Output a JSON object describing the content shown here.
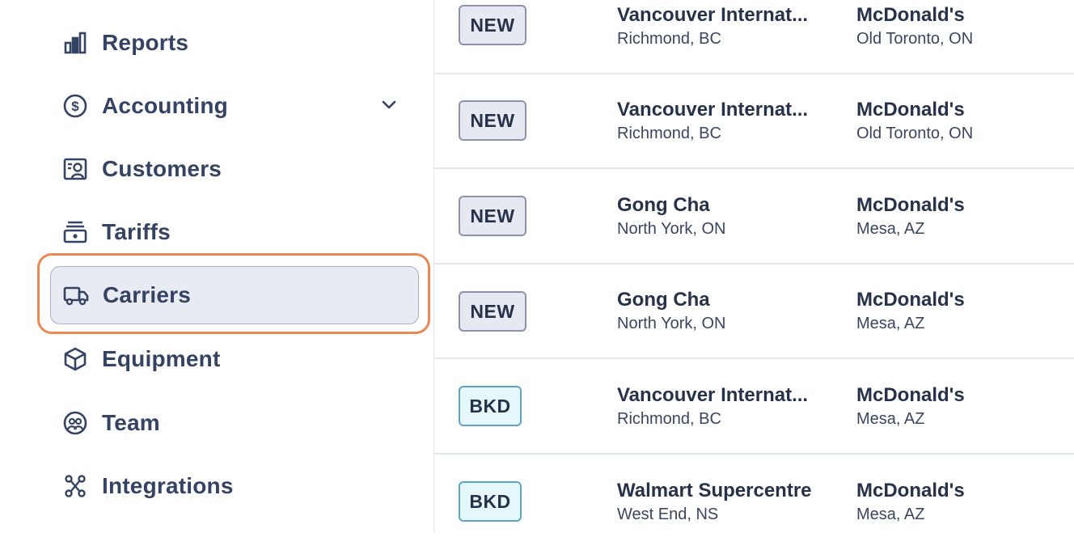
{
  "sidebar": {
    "items": [
      {
        "label": "Reports",
        "icon": "bar-chart-icon"
      },
      {
        "label": "Accounting",
        "icon": "dollar-circle-icon"
      },
      {
        "label": "Customers",
        "icon": "customer-card-icon"
      },
      {
        "label": "Tariffs",
        "icon": "tariff-icon"
      },
      {
        "label": "Carriers",
        "icon": "truck-icon"
      },
      {
        "label": "Equipment",
        "icon": "cube-icon"
      },
      {
        "label": "Team",
        "icon": "team-icon"
      },
      {
        "label": "Integrations",
        "icon": "integrations-icon"
      }
    ],
    "active": "Carriers",
    "accent_color": "#ea8753"
  },
  "rows": [
    {
      "status": "NEW",
      "origin_name": "Vancouver Internat...",
      "origin_loc": "Richmond, BC",
      "dest_name": "McDonald's",
      "dest_loc": "Old Toronto, ON"
    },
    {
      "status": "NEW",
      "origin_name": "Vancouver Internat...",
      "origin_loc": "Richmond, BC",
      "dest_name": "McDonald's",
      "dest_loc": "Old Toronto, ON"
    },
    {
      "status": "NEW",
      "origin_name": "Gong Cha",
      "origin_loc": "North York, ON",
      "dest_name": "McDonald's",
      "dest_loc": "Mesa, AZ"
    },
    {
      "status": "NEW",
      "origin_name": "Gong Cha",
      "origin_loc": "North York, ON",
      "dest_name": "McDonald's",
      "dest_loc": "Mesa, AZ"
    },
    {
      "status": "BKD",
      "origin_name": "Vancouver Internat...",
      "origin_loc": "Richmond, BC",
      "dest_name": "McDonald's",
      "dest_loc": "Mesa, AZ"
    },
    {
      "status": "BKD",
      "origin_name": "Walmart Supercentre",
      "origin_loc": "West End, NS",
      "dest_name": "McDonald's",
      "dest_loc": "Mesa, AZ"
    }
  ]
}
